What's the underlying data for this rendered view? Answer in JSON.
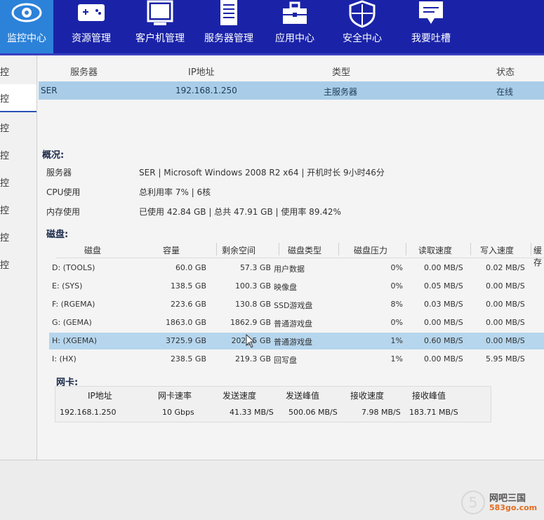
{
  "nav": [
    {
      "label": "监控中心",
      "icon": "eye-icon",
      "active": true
    },
    {
      "label": "资源管理",
      "icon": "gamepad-icon",
      "active": false
    },
    {
      "label": "客户机管理",
      "icon": "monitor-icon",
      "active": false
    },
    {
      "label": "服务器管理",
      "icon": "server-icon",
      "active": false
    },
    {
      "label": "应用中心",
      "icon": "toolbox-icon",
      "active": false
    },
    {
      "label": "安全中心",
      "icon": "shield-icon",
      "active": false
    },
    {
      "label": "我要吐槽",
      "icon": "comment-icon",
      "active": false
    }
  ],
  "sidebar": [
    "控",
    "控",
    "控",
    "控",
    "控",
    "控",
    "控",
    "控"
  ],
  "server_table": {
    "headers": [
      "服务器",
      "IP地址",
      "类型",
      "状态"
    ],
    "row": {
      "name": "SER",
      "ip": "192.168.1.250",
      "type": "主服务器",
      "status": "在线"
    }
  },
  "overview": {
    "title": "概况:",
    "server_label": "服务器",
    "server_value": "SER | Microsoft Windows 2008 R2 x64 | 开机时长 9小时46分",
    "cpu_label": "CPU使用",
    "cpu_value": "总利用率 7% | 6核",
    "mem_label": "内存使用",
    "mem_value": "已使用 42.84 GB | 总共 47.91 GB | 使用率 89.42%"
  },
  "disk": {
    "title": "磁盘:",
    "headers": [
      "磁盘",
      "容量",
      "剩余空间",
      "磁盘类型",
      "磁盘压力",
      "读取速度",
      "写入速度",
      "缓存"
    ],
    "rows": [
      {
        "name": "D: (TOOLS)",
        "cap": "60.0 GB",
        "free": "57.3 GB",
        "type": "用户数据",
        "load": "0%",
        "read": "0.00 MB/S",
        "write": "0.02 MB/S"
      },
      {
        "name": "E: (SYS)",
        "cap": "138.5 GB",
        "free": "100.3 GB",
        "type": "映像盘",
        "load": "0%",
        "read": "0.05 MB/S",
        "write": "0.00 MB/S"
      },
      {
        "name": "F: (RGEMA)",
        "cap": "223.6 GB",
        "free": "130.8 GB",
        "type": "SSD游戏盘",
        "load": "8%",
        "read": "0.03 MB/S",
        "write": "0.00 MB/S"
      },
      {
        "name": "G: (GEMA)",
        "cap": "1863.0 GB",
        "free": "1862.9 GB",
        "type": "普通游戏盘",
        "load": "0%",
        "read": "0.00 MB/S",
        "write": "0.00 MB/S"
      },
      {
        "name": "H: (XGEMA)",
        "cap": "3725.9 GB",
        "free": "202_.5 GB",
        "type": "普通游戏盘",
        "load": "1%",
        "read": "0.60 MB/S",
        "write": "0.00 MB/S"
      },
      {
        "name": "I: (HX)",
        "cap": "238.5 GB",
        "free": "219.3 GB",
        "type": "回写盘",
        "load": "1%",
        "read": "0.00 MB/S",
        "write": "5.95 MB/S"
      }
    ]
  },
  "nic": {
    "title": "网卡:",
    "headers": [
      "IP地址",
      "网卡速率",
      "发送速度",
      "发送峰值",
      "接收速度",
      "接收峰值"
    ],
    "row": {
      "ip": "192.168.1.250",
      "rate": "10 Gbps",
      "send": "41.33 MB/S",
      "send_peak": "500.06 MB/S",
      "recv": "7.98 MB/S",
      "recv_peak": "183.71 MB/S"
    }
  },
  "watermark": {
    "logo": "5",
    "name": "网吧三国",
    "site": "583go.com"
  }
}
